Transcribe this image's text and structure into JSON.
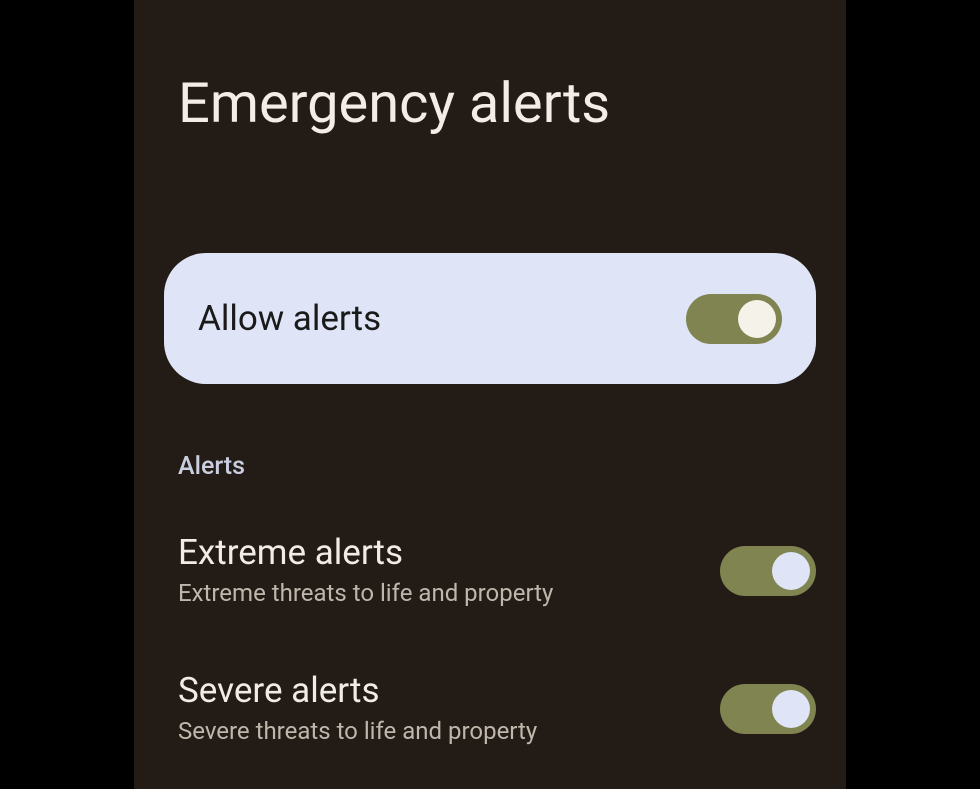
{
  "page": {
    "title": "Emergency alerts"
  },
  "primary": {
    "label": "Allow alerts",
    "state": "on"
  },
  "section": {
    "header": "Alerts"
  },
  "settings": [
    {
      "title": "Extreme alerts",
      "subtitle": "Extreme threats to life and property",
      "state": "on"
    },
    {
      "title": "Severe alerts",
      "subtitle": "Severe threats to life and property",
      "state": "on"
    }
  ],
  "colors": {
    "background": "#231c16",
    "card": "#dfe5f7",
    "toggleOn": "#7f8450",
    "text": "#f2ece6",
    "subtext": "#bfb6ac",
    "sectionHeader": "#c9cfe0"
  }
}
